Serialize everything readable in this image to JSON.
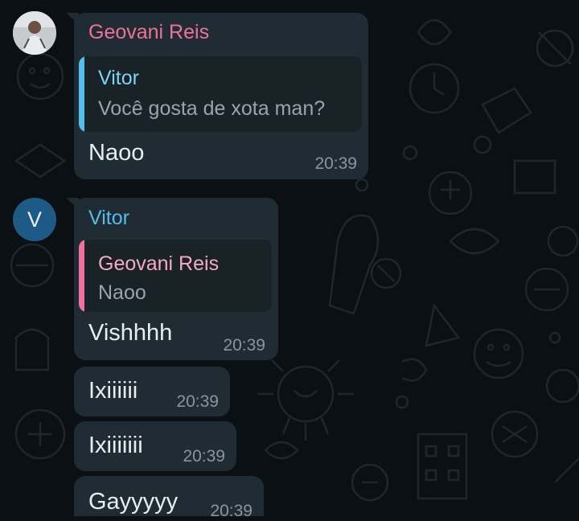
{
  "colors": {
    "background": "#0b1014",
    "bubble": "#1f2c33",
    "quote_background": "#182227",
    "geovani_name": "#f0719b",
    "vitor_name": "#53bdeb",
    "quote_author_pink": "#f7a8c7",
    "quote_author_blue": "#7dd3f2",
    "timestamp": "#8a959c"
  },
  "chat": {
    "groups": [
      {
        "sender": "Geovani Reis",
        "avatar": "profile-photo",
        "messages": [
          {
            "quote": {
              "author": "Vitor",
              "text": "Você gosta de xota man?"
            },
            "text": "Naoo",
            "time": "20:39"
          }
        ]
      },
      {
        "sender": "Vitor",
        "avatar_letter": "V",
        "messages": [
          {
            "quote": {
              "author": "Geovani Reis",
              "text": "Naoo"
            },
            "text": "Vishhhh",
            "time": "20:39"
          },
          {
            "text": "Ixiiiiii",
            "time": "20:39"
          },
          {
            "text": "Ixiiiiiii",
            "time": "20:39"
          },
          {
            "text": "Gayyyyy",
            "time": "20:39"
          }
        ]
      }
    ]
  }
}
